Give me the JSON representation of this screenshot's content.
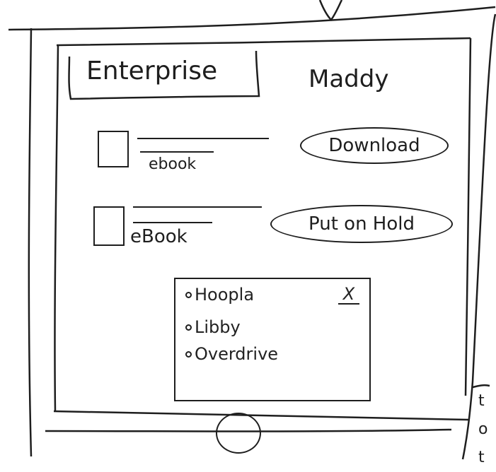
{
  "header": {
    "brand": "Enterprise",
    "user": "Maddy"
  },
  "items": [
    {
      "format": "ebook",
      "action": "Download"
    },
    {
      "format": "eBook",
      "action": "Put on Hold"
    }
  ],
  "popup": {
    "close": "X",
    "options": [
      "Hoopla",
      "Libby",
      "Overdrive"
    ]
  },
  "margin_note": "t o t"
}
